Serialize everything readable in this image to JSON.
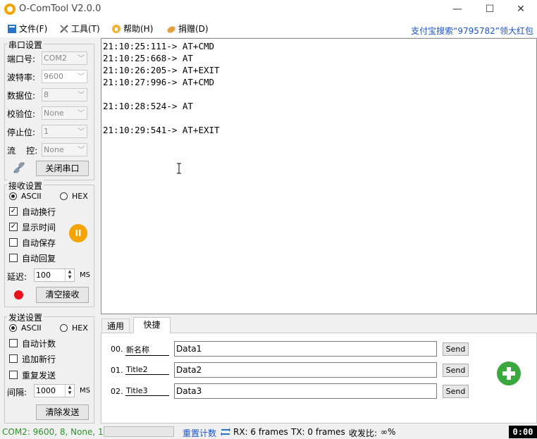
{
  "window": {
    "title": "O-ComTool V2.0.0",
    "minimize_glyph": "—",
    "maximize_glyph": "☐",
    "close_glyph": "✕"
  },
  "menu": {
    "file": "文件(F)",
    "tools": "工具(T)",
    "help": "帮助(H)",
    "donate": "捐赠(D)",
    "promo": "支付宝搜索“9795782”领大红包"
  },
  "serial": {
    "title": "串口设置",
    "port_label": "端口号:",
    "port_value": "COM2",
    "baud_label": "波特率:",
    "baud_value": "9600",
    "databits_label": "数据位:",
    "databits_value": "8",
    "parity_label": "校验位:",
    "parity_value": "None",
    "stopbits_label": "停止位:",
    "stopbits_value": "1",
    "flow_label": "流    控:",
    "flow_value": "None",
    "close_button": "关闭串口"
  },
  "receive": {
    "title": "接收设置",
    "ascii": "ASCII",
    "hex": "HEX",
    "auto_wrap": "自动换行",
    "show_time": "显示时间",
    "auto_save": "自动保存",
    "auto_reply": "自动回复",
    "delay_label": "延迟:",
    "delay_value": "100",
    "delay_unit": "MS",
    "clear_button": "清空接收",
    "pause_glyph": "II"
  },
  "send": {
    "title": "发送设置",
    "ascii": "ASCII",
    "hex": "HEX",
    "auto_count": "自动计数",
    "append_newline": "追加新行",
    "repeat_send": "重复发送",
    "interval_label": "间隔:",
    "interval_value": "1000",
    "interval_unit": "MS",
    "clear_button": "清除发送"
  },
  "log": [
    "21:10:25:111-> AT+CMD",
    "21:10:25:668-> AT",
    "21:10:26:205-> AT+EXIT",
    "21:10:27:996-> AT+CMD",
    "",
    "21:10:28:524-> AT",
    "",
    "21:10:29:541-> AT+EXIT"
  ],
  "tabs": {
    "general": "通用",
    "quick": "快捷"
  },
  "quick_send": [
    {
      "num": "00.",
      "name": "新名称",
      "data": "Data1",
      "button": "Send"
    },
    {
      "num": "01.",
      "name": "Title2",
      "data": "Data2",
      "button": "Send"
    },
    {
      "num": "02.",
      "name": "Title3",
      "data": "Data3",
      "button": "Send"
    }
  ],
  "status": {
    "port_info": "COM2: 9600, 8, None, 1",
    "reset_count": "重置计数",
    "rx": "RX: 6 frames",
    "tx": "TX: 0 frames",
    "ratio_label": "收发比:",
    "ratio_value": "∞%",
    "timer": "0:00"
  },
  "colors": {
    "accent_orange": "#f5a300",
    "record_red": "#e8121b",
    "add_green": "#3aa83f",
    "status_green": "#2f8f2f",
    "link_blue": "#1a55c5"
  }
}
